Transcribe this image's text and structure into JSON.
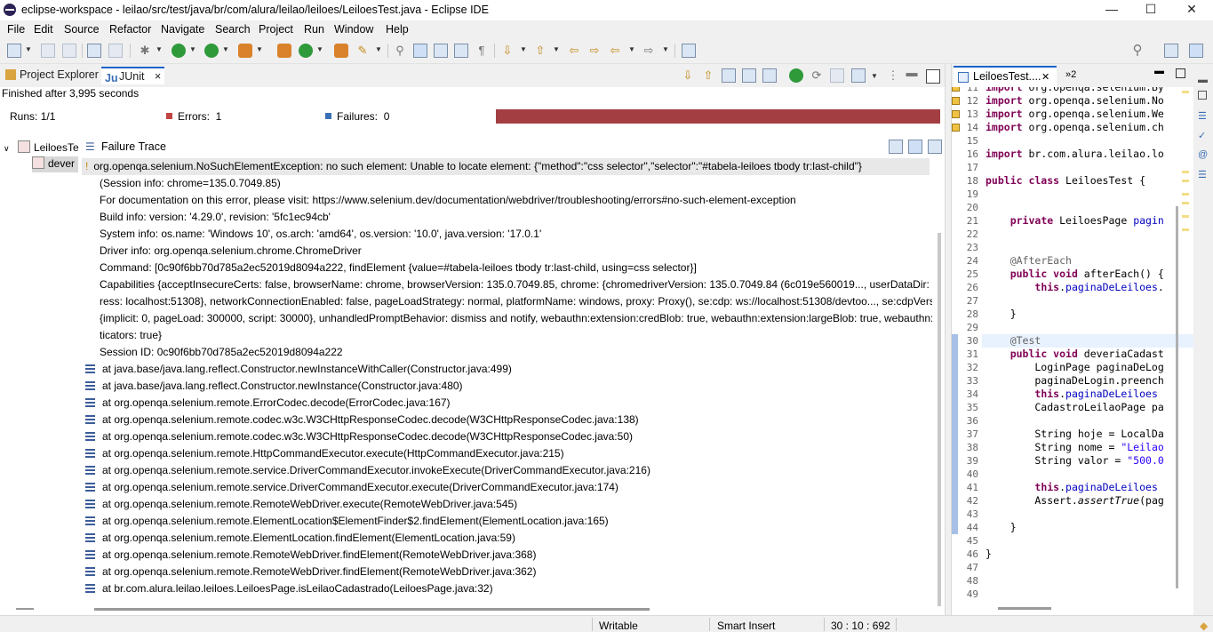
{
  "window": {
    "title": "eclipse-workspace - leilao/src/test/java/br/com/alura/leilao/leiloes/LeiloesTest.java - Eclipse IDE",
    "controls": {
      "minimize": "—",
      "maximize": "☐",
      "close": "✕"
    }
  },
  "menu": [
    "File",
    "Edit",
    "Source",
    "Refactor",
    "Navigate",
    "Search",
    "Project",
    "Run",
    "Window",
    "Help"
  ],
  "views": {
    "tabs": [
      {
        "label": "Project Explorer",
        "active": false
      },
      {
        "label": "JUnit",
        "active": true
      }
    ],
    "close_symbol": "×"
  },
  "junit": {
    "status": "Finished after 3,995 seconds",
    "runs_label": "Runs:",
    "runs_value": "1/1",
    "errors_label": "Errors:",
    "errors_value": "1",
    "failures_label": "Failures:",
    "failures_value": "0",
    "bar_color": "#a33f43",
    "tree": [
      {
        "label": "LeiloesTe",
        "expanded": true
      },
      {
        "label": "dever",
        "selected": true
      }
    ],
    "failure_trace_title": "Failure Trace",
    "trace": [
      "org.openqa.selenium.NoSuchElementException: no such element: Unable to locate element: {\"method\":\"css selector\",\"selector\":\"#tabela-leiloes tbody tr:last-child\"}",
      "  (Session info: chrome=135.0.7049.85)",
      "For documentation on this error, please visit: https://www.selenium.dev/documentation/webdriver/troubleshooting/errors#no-such-element-exception",
      "Build info: version: '4.29.0', revision: '5fc1ec94cb'",
      "System info: os.name: 'Windows 10', os.arch: 'amd64', os.version: '10.0', java.version: '17.0.1'",
      "Driver info: org.openqa.selenium.chrome.ChromeDriver",
      "Command: [0c90f6bb70d785a2ec52019d8094a222, findElement {value=#tabela-leiloes tbody tr:last-child, using=css selector}]",
      "Capabilities {acceptInsecureCerts: false, browserName: chrome, browserVersion: 135.0.7049.85, chrome: {chromedriverVersion: 135.0.7049.84 (6c019e560019..., userDataDir: C:\\Users",
      "ress: localhost:51308}, networkConnectionEnabled: false, pageLoadStrategy: normal, platformName: windows, proxy: Proxy(), se:cdp: ws://localhost:51308/devtoo..., se:cdpVersion",
      " {implicit: 0, pageLoad: 300000, script: 30000}, unhandledPromptBehavior: dismiss and notify, webauthn:extension:credBlob: true, webauthn:extension:largeBlob: true, webauthn:e",
      "ticators: true}",
      "Session ID: 0c90f6bb70d785a2ec52019d8094a222"
    ],
    "stack": [
      "at java.base/java.lang.reflect.Constructor.newInstanceWithCaller(Constructor.java:499)",
      "at java.base/java.lang.reflect.Constructor.newInstance(Constructor.java:480)",
      "at org.openqa.selenium.remote.ErrorCodec.decode(ErrorCodec.java:167)",
      "at org.openqa.selenium.remote.codec.w3c.W3CHttpResponseCodec.decode(W3CHttpResponseCodec.java:138)",
      "at org.openqa.selenium.remote.codec.w3c.W3CHttpResponseCodec.decode(W3CHttpResponseCodec.java:50)",
      "at org.openqa.selenium.remote.HttpCommandExecutor.execute(HttpCommandExecutor.java:215)",
      "at org.openqa.selenium.remote.service.DriverCommandExecutor.invokeExecute(DriverCommandExecutor.java:216)",
      "at org.openqa.selenium.remote.service.DriverCommandExecutor.execute(DriverCommandExecutor.java:174)",
      "at org.openqa.selenium.remote.RemoteWebDriver.execute(RemoteWebDriver.java:545)",
      "at org.openqa.selenium.remote.ElementLocation$ElementFinder$2.findElement(ElementLocation.java:165)",
      "at org.openqa.selenium.remote.ElementLocation.findElement(ElementLocation.java:59)",
      "at org.openqa.selenium.remote.RemoteWebDriver.findElement(RemoteWebDriver.java:368)",
      "at org.openqa.selenium.remote.RemoteWebDriver.findElement(RemoteWebDriver.java:362)",
      "at br.com.alura.leilao.leiloes.LeiloesPage.isLeilaoCadastrado(LeiloesPage.java:32)"
    ]
  },
  "editor": {
    "tab_label": "LeiloesTest....",
    "tab_close": "✕",
    "overflow_label": "»2",
    "lines": [
      {
        "n": "11",
        "html": "<span class='kw'>import</span> org.openqa.selenium.By"
      },
      {
        "n": "12",
        "html": "<span class='kw'>import</span> org.openqa.selenium.No"
      },
      {
        "n": "13",
        "html": "<span class='kw'>import</span> org.openqa.selenium.We"
      },
      {
        "n": "14",
        "html": "<span class='kw'>import</span> org.openqa.selenium.ch"
      },
      {
        "n": "15",
        "html": ""
      },
      {
        "n": "16",
        "html": "<span class='kw'>import</span> br.com.alura.leilao.lo"
      },
      {
        "n": "17",
        "html": ""
      },
      {
        "n": "18",
        "html": "<span class='kw'>public class</span> LeiloesTest {"
      },
      {
        "n": "19",
        "html": ""
      },
      {
        "n": "20",
        "html": ""
      },
      {
        "n": "21",
        "html": "    <span class='kw'>private</span> LeiloesPage <span class='fld'>pagin</span>"
      },
      {
        "n": "22",
        "html": ""
      },
      {
        "n": "23",
        "html": ""
      },
      {
        "n": "24",
        "html": "    <span class='ann'>@AfterEach</span>"
      },
      {
        "n": "25",
        "html": "    <span class='kw'>public void</span> afterEach() {"
      },
      {
        "n": "26",
        "html": "        <span class='kw'>this</span>.<span class='fld'>paginaDeLeiloes</span>."
      },
      {
        "n": "27",
        "html": ""
      },
      {
        "n": "28",
        "html": "    }"
      },
      {
        "n": "29",
        "html": ""
      },
      {
        "n": "30",
        "html": "    <span class='ann'>@Test</span>"
      },
      {
        "n": "31",
        "html": "    <span class='kw'>public void</span> deveriaCadast"
      },
      {
        "n": "32",
        "html": "        LoginPage paginaDeLog"
      },
      {
        "n": "33",
        "html": "        paginaDeLogin.preench"
      },
      {
        "n": "34",
        "html": "        <span class='kw'>this</span>.<span class='fld'>paginaDeLeiloes</span>"
      },
      {
        "n": "35",
        "html": "        CadastroLeilaoPage pa"
      },
      {
        "n": "36",
        "html": ""
      },
      {
        "n": "37",
        "html": "        String hoje = LocalDa"
      },
      {
        "n": "38",
        "html": "        String nome = <span class='str'>\"Leilao</span>"
      },
      {
        "n": "39",
        "html": "        String valor = <span class='str'>\"500.0</span>"
      },
      {
        "n": "40",
        "html": ""
      },
      {
        "n": "41",
        "html": "        <span class='kw'>this</span>.<span class='fld'>paginaDeLeiloes</span>"
      },
      {
        "n": "42",
        "html": "        Assert.<span class='it'>assertTrue</span>(pag"
      },
      {
        "n": "43",
        "html": ""
      },
      {
        "n": "44",
        "html": "    }"
      },
      {
        "n": "45",
        "html": ""
      },
      {
        "n": "46",
        "html": "}"
      },
      {
        "n": "47",
        "html": ""
      },
      {
        "n": "48",
        "html": ""
      },
      {
        "n": "49",
        "html": ""
      }
    ]
  },
  "statusbar": {
    "writable": "Writable",
    "insert_mode": "Smart Insert",
    "position": "30 : 10 : 692"
  },
  "colors": {
    "accent": "#1e62c8",
    "error_bar": "#a33f43"
  }
}
